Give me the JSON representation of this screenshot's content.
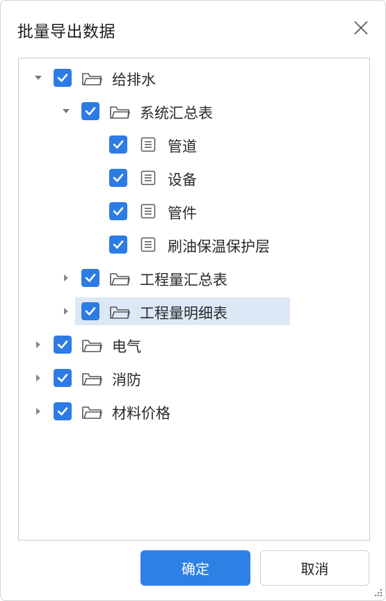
{
  "dialog": {
    "title": "批量导出数据",
    "confirm_label": "确定",
    "cancel_label": "取消"
  },
  "tree": {
    "nodes": [
      {
        "label": "给排水",
        "type": "folder",
        "expanded": true,
        "checked": true
      },
      {
        "label": "系统汇总表",
        "type": "folder",
        "expanded": true,
        "checked": true
      },
      {
        "label": "管道",
        "type": "file",
        "checked": true
      },
      {
        "label": "设备",
        "type": "file",
        "checked": true
      },
      {
        "label": "管件",
        "type": "file",
        "checked": true
      },
      {
        "label": "刷油保温保护层",
        "type": "file",
        "checked": true
      },
      {
        "label": "工程量汇总表",
        "type": "folder",
        "expanded": false,
        "checked": true
      },
      {
        "label": "工程量明细表",
        "type": "folder",
        "expanded": false,
        "checked": true,
        "selected": true
      },
      {
        "label": "电气",
        "type": "folder",
        "expanded": false,
        "checked": true
      },
      {
        "label": "消防",
        "type": "folder",
        "expanded": false,
        "checked": true
      },
      {
        "label": "材料价格",
        "type": "folder",
        "expanded": false,
        "checked": true
      }
    ]
  },
  "colors": {
    "accent": "#2d7be5",
    "primary_button": "#2f80e4",
    "selection": "#dde8f7"
  },
  "icons": {
    "close": "close-icon",
    "folder": "folder-icon",
    "file": "document-icon",
    "check": "check-icon",
    "expanded": "caret-down-icon",
    "collapsed": "caret-right-icon",
    "resize": "resize-grip-icon"
  }
}
